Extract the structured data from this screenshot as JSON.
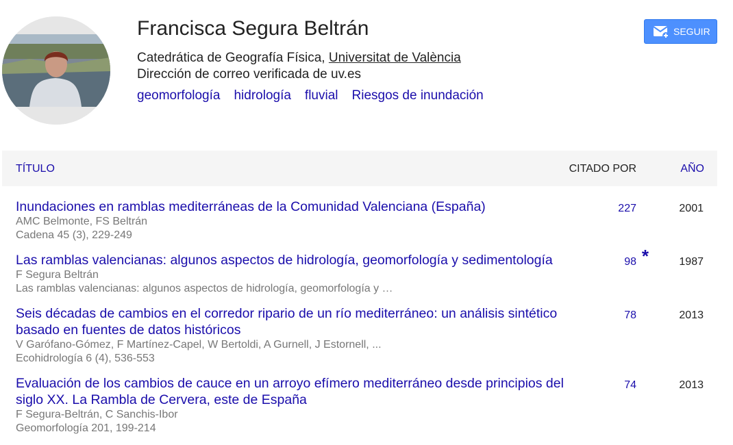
{
  "profile": {
    "name": "Francisca Segura Beltrán",
    "affiliation_prefix": "Catedrática de Geografía Física, ",
    "affiliation_org": "Universitat de València",
    "email_text": "Dirección de correo verificada de uv.es",
    "interests": [
      "geomorfología",
      "hidrología",
      "fluvial",
      "Riesgos de inundación"
    ],
    "follow_label": "SEGUIR"
  },
  "table": {
    "headers": {
      "title": "TÍTULO",
      "cited_by": "CITADO POR",
      "year": "AÑO"
    },
    "articles": [
      {
        "title": "Inundaciones en ramblas mediterráneas de la Comunidad Valenciana (España)",
        "authors": "AMC Belmonte, FS Beltrán",
        "venue": "Cadena 45 (3), 229-249",
        "cited_by": "227",
        "star": "",
        "year": "2001"
      },
      {
        "title": "Las ramblas valencianas: algunos aspectos de hidrología, geomorfología y sedimentología",
        "authors": "F Segura Beltrán",
        "venue": "Las ramblas valencianas: algunos aspectos de hidrología, geomorfología y …",
        "cited_by": "98",
        "star": "*",
        "year": "1987"
      },
      {
        "title": "Seis décadas de cambios en el corredor ripario de un río mediterráneo: un análisis sintético basado en fuentes de datos históricos",
        "authors": "V Garófano-Gómez, F Martínez-Capel, W Bertoldi, A Gurnell, J Estornell, ...",
        "venue": "Ecohidrología 6 (4), 536-553",
        "cited_by": "78",
        "star": "",
        "year": "2013"
      },
      {
        "title": "Evaluación de los cambios de cauce en un arroyo efímero mediterráneo desde principios del siglo XX. La Rambla de Cervera, este de España",
        "authors": "F Segura-Beltrán, C Sanchis-Ibor",
        "venue": "Geomorfología 201, 199-214",
        "cited_by": "74",
        "star": "",
        "year": "2013"
      }
    ]
  },
  "colors": {
    "link": "#1a0dab",
    "button": "#4d90fe",
    "header_bg": "#f5f5f5",
    "meta_text": "#777777"
  },
  "icons": {
    "follow": "email-add-icon"
  }
}
